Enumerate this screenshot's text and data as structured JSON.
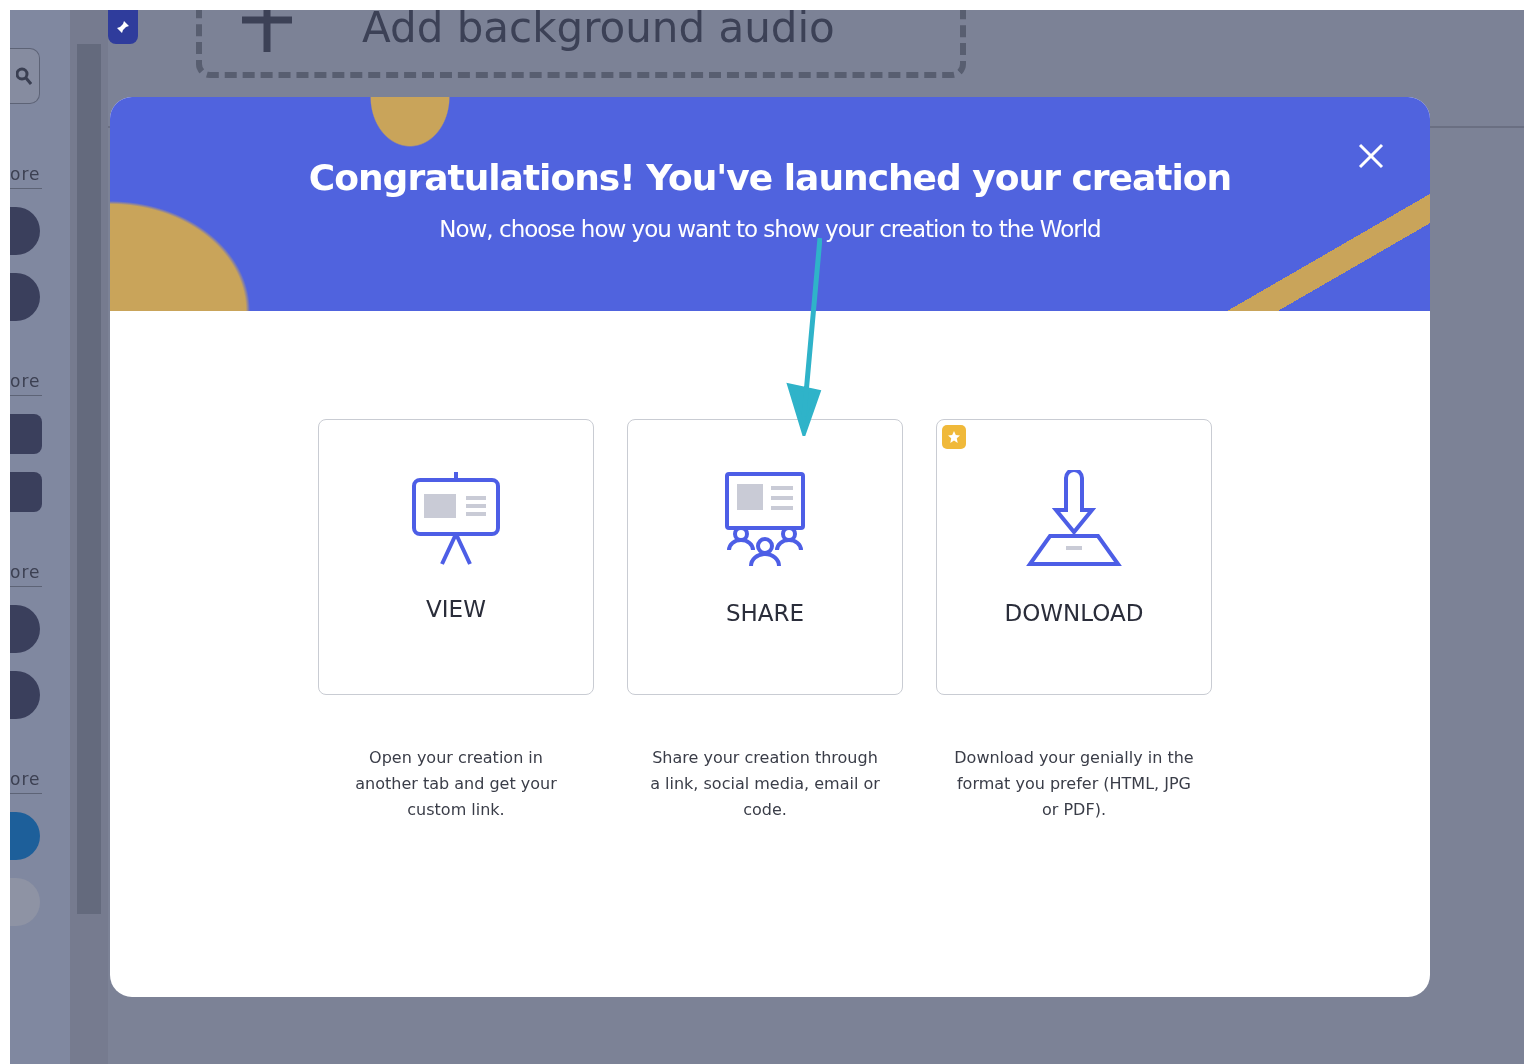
{
  "background": {
    "sidebar": {
      "sections": [
        {
          "label": "ore",
          "kind": "round"
        },
        {
          "label": "ore",
          "kind": "square"
        },
        {
          "label": "ore",
          "kind": "pin"
        },
        {
          "label": "ore",
          "kind": "social"
        }
      ]
    },
    "audio_button": {
      "label": "Add background audio"
    }
  },
  "dialog": {
    "title": "Congratulations! You've launched your creation",
    "subtitle": "Now, choose how you want to show your creation to the World",
    "options": [
      {
        "kind": "view",
        "label": "VIEW",
        "premium": false,
        "description": "Open your creation in another tab and get your custom link."
      },
      {
        "kind": "share",
        "label": "SHARE",
        "premium": false,
        "description": "Share your creation through a link, social media, email or code."
      },
      {
        "kind": "download",
        "label": "DOWNLOAD",
        "premium": true,
        "description": "Download your genially in the format you prefer (HTML, JPG or PDF)."
      }
    ]
  }
}
